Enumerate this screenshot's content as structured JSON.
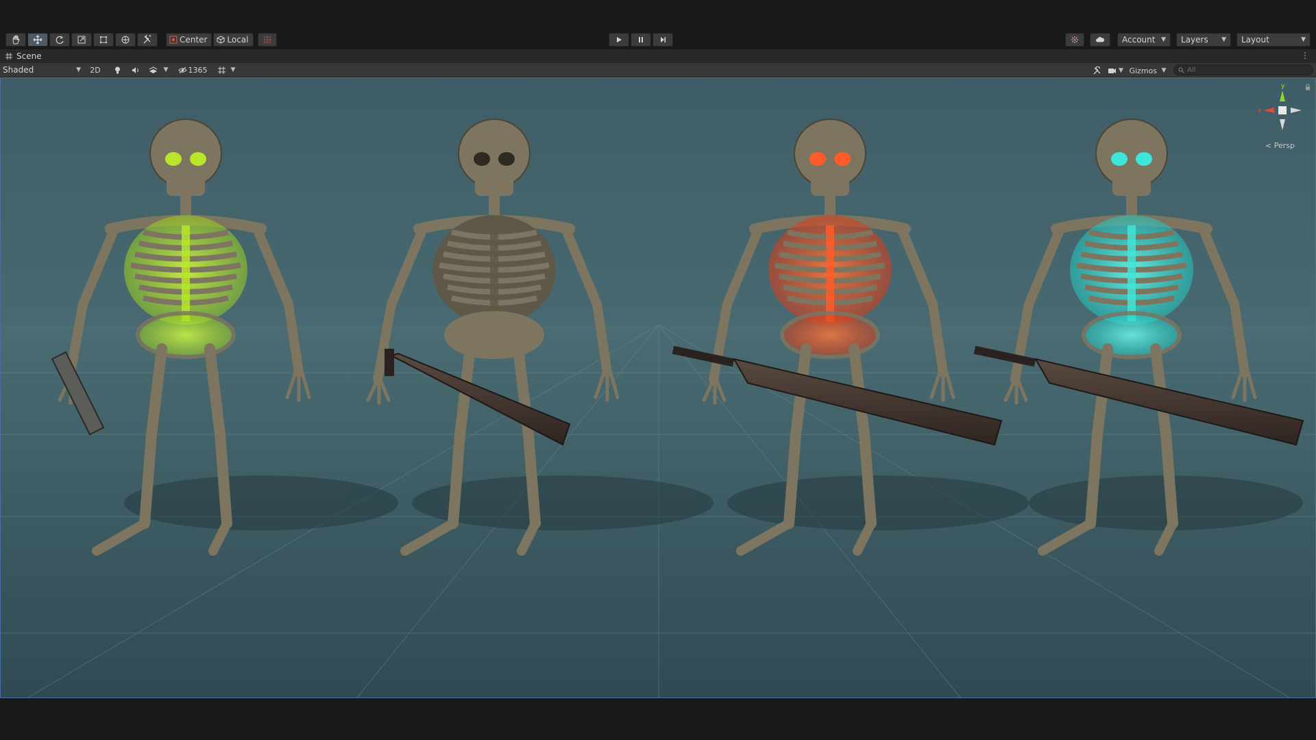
{
  "toolbar": {
    "tools": [
      {
        "name": "hand-tool-icon"
      },
      {
        "name": "move-tool-icon"
      },
      {
        "name": "rotate-tool-icon"
      },
      {
        "name": "scale-tool-icon"
      },
      {
        "name": "rect-tool-icon"
      },
      {
        "name": "transform-tool-icon"
      },
      {
        "name": "custom-tool-icon"
      }
    ],
    "pivot_mode": "Center",
    "pivot_rotation": "Local",
    "account_label": "Account",
    "layers_label": "Layers",
    "layout_label": "Layout"
  },
  "scene_tab": {
    "label": "Scene"
  },
  "scene_toolbar": {
    "draw_mode": "Shaded",
    "mode_2d": "2D",
    "hidden_count": "1365",
    "gizmos_label": "Gizmos",
    "search_placeholder": "All"
  },
  "view_gizmo": {
    "y_label": "y",
    "x_label": "x",
    "projection": "< Persp"
  },
  "scene": {
    "characters": [
      {
        "name": "skeleton-green-glow",
        "glow": "#b8e62a",
        "weapon": "cleaver"
      },
      {
        "name": "skeleton-plain",
        "glow": "#8a8468",
        "weapon": "machete"
      },
      {
        "name": "skeleton-orange-glow",
        "glow": "#ff5a28",
        "weapon": "long-sword"
      },
      {
        "name": "skeleton-cyan-glow",
        "glow": "#3de6d8",
        "weapon": "long-sword"
      }
    ],
    "bone_color": "#7d7560"
  }
}
